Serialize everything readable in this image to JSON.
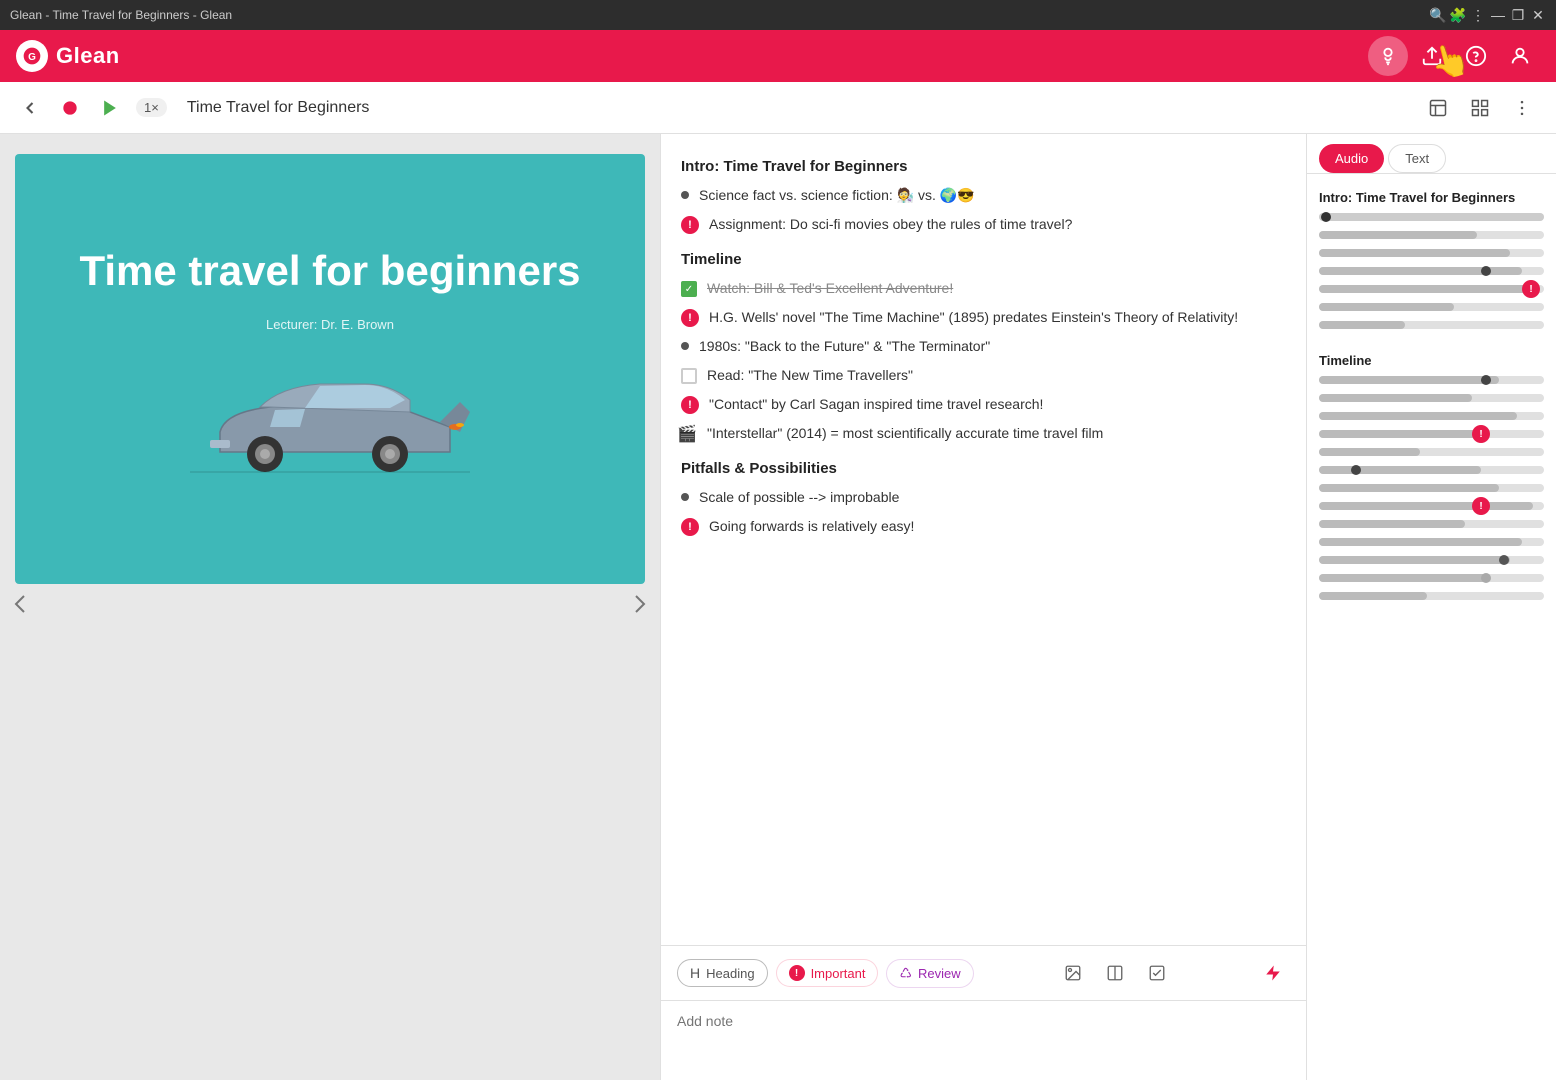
{
  "titleBar": {
    "title": "Glean - Time Travel for Beginners - Glean",
    "searchIcon": "🔍",
    "extensionIcon": "🧩",
    "menuIcon": "⋮",
    "minIcon": "—",
    "maxIcon": "❐",
    "closeIcon": "✕"
  },
  "topNav": {
    "logoText": "Glean",
    "bulbIcon": "💡",
    "uploadIcon": "⬆",
    "helpIcon": "?",
    "userIcon": "👤"
  },
  "toolbar": {
    "backIcon": "←",
    "recordLabel": "●",
    "playLabel": "▶",
    "speedLabel": "1×",
    "docTitle": "Time Travel for Beginners",
    "notesIcon": "📝",
    "layoutIcon": "▦",
    "moreIcon": "⋮"
  },
  "slide": {
    "title": "Time travel for beginners",
    "lecturer": "Lecturer: Dr. E. Brown"
  },
  "notes": {
    "sections": [
      {
        "heading": "Intro: Time Travel for Beginners",
        "items": [
          {
            "type": "bullet",
            "text": "Science fact vs. science fiction: 🧑‍🔬 vs. 🌍😎"
          },
          {
            "type": "important",
            "text": "Assignment: Do sci-fi movies obey the rules of time travel?"
          }
        ]
      },
      {
        "heading": "Timeline",
        "items": [
          {
            "type": "checkbox-checked",
            "text": "Watch: Bill & Ted's Excellent Adventure!",
            "strikethrough": true
          },
          {
            "type": "important",
            "text": "H.G. Wells' novel \"The Time Machine\" (1895) predates Einstein's Theory of Relativity!"
          },
          {
            "type": "bullet",
            "text": "1980s: \"Back to the Future\" & \"The Terminator\""
          },
          {
            "type": "checkbox",
            "text": "Read: \"The New Time Travellers\""
          },
          {
            "type": "important",
            "text": "\"Contact\" by Carl Sagan inspired time travel research!"
          },
          {
            "type": "bullet-emoji",
            "emoji": "🎬",
            "text": "\"Interstellar\" (2014) = most scientifically accurate time travel film"
          }
        ]
      },
      {
        "heading": "Pitfalls & Possibilities",
        "items": [
          {
            "type": "bullet",
            "text": "Scale of possible --> improbable"
          },
          {
            "type": "important",
            "text": "Going forwards is relatively easy!"
          }
        ]
      }
    ],
    "addNotePlaceholder": "Add note",
    "toolbarTags": [
      {
        "id": "heading",
        "icon": "H",
        "label": "Heading"
      },
      {
        "id": "important",
        "icon": "!",
        "label": "Important"
      },
      {
        "id": "review",
        "icon": "♺",
        "label": "Review"
      }
    ]
  },
  "waveform": {
    "tabs": [
      {
        "id": "audio",
        "label": "Audio",
        "active": true
      },
      {
        "id": "text",
        "label": "Text",
        "active": false
      }
    ],
    "sections": [
      {
        "title": "Intro: Time Travel for Beginners",
        "tracks": [
          {
            "fill": 5,
            "dotPos": 5,
            "hasImportant": false,
            "dotColor": "dark"
          },
          {
            "fill": 60,
            "dotPos": null,
            "hasImportant": false
          },
          {
            "fill": 80,
            "dotPos": null,
            "hasImportant": false
          },
          {
            "fill": 72,
            "dotPos": 72,
            "hasImportant": false,
            "dotColor": "dark"
          },
          {
            "fill": 90,
            "dotPos": null,
            "hasImportant": true,
            "importantPos": 90
          },
          {
            "fill": 55,
            "dotPos": null,
            "hasImportant": false
          },
          {
            "fill": 30,
            "dotPos": null,
            "hasImportant": false
          }
        ]
      },
      {
        "title": "Timeline",
        "tracks": [
          {
            "fill": 75,
            "dotPos": 75,
            "hasImportant": false,
            "dotColor": "dark"
          },
          {
            "fill": 65,
            "dotPos": null,
            "hasImportant": false
          },
          {
            "fill": 85,
            "dotPos": null,
            "hasImportant": false
          },
          {
            "fill": 72,
            "dotPos": 72,
            "hasImportant": true,
            "importantPos": 72
          },
          {
            "fill": 40,
            "dotPos": null,
            "hasImportant": false
          },
          {
            "fill": 68,
            "dotPos": 15,
            "hasImportant": false,
            "dotColor": "dark"
          },
          {
            "fill": 80,
            "dotPos": null,
            "hasImportant": false
          },
          {
            "fill": 72,
            "dotPos": null,
            "hasImportant": true,
            "importantPos": 70
          },
          {
            "fill": 65,
            "dotPos": null,
            "hasImportant": false
          },
          {
            "fill": 88,
            "dotPos": null,
            "hasImportant": false
          },
          {
            "fill": 80,
            "dotPos": 80,
            "hasImportant": false,
            "dotColor": "dark"
          },
          {
            "fill": 72,
            "dotPos": 72,
            "hasImportant": false,
            "dotColor": "gray"
          },
          {
            "fill": 45,
            "dotPos": null,
            "hasImportant": false
          }
        ]
      }
    ]
  }
}
